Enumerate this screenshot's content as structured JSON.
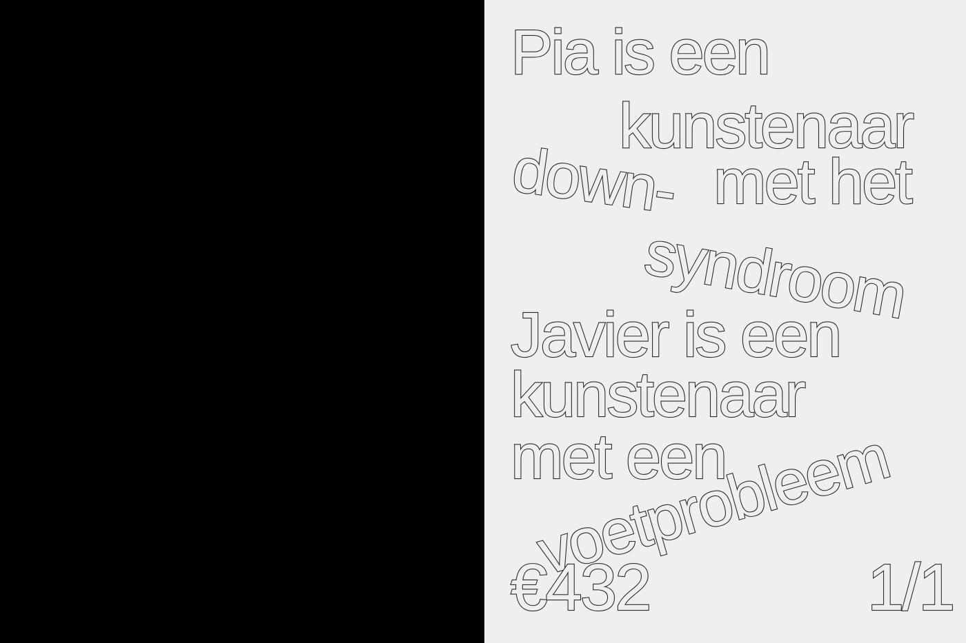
{
  "cover": {
    "lines": [
      "Pia is een",
      "kunstenaar",
      "down-",
      "met het",
      "syndroom",
      "Javier is een",
      "kunstenaar",
      "met een",
      "voetprobleem"
    ],
    "price": "€432",
    "edition": "1/1"
  },
  "colors": {
    "background": "#000000",
    "paper": "#efefed",
    "outline": "#2a2a2a"
  }
}
